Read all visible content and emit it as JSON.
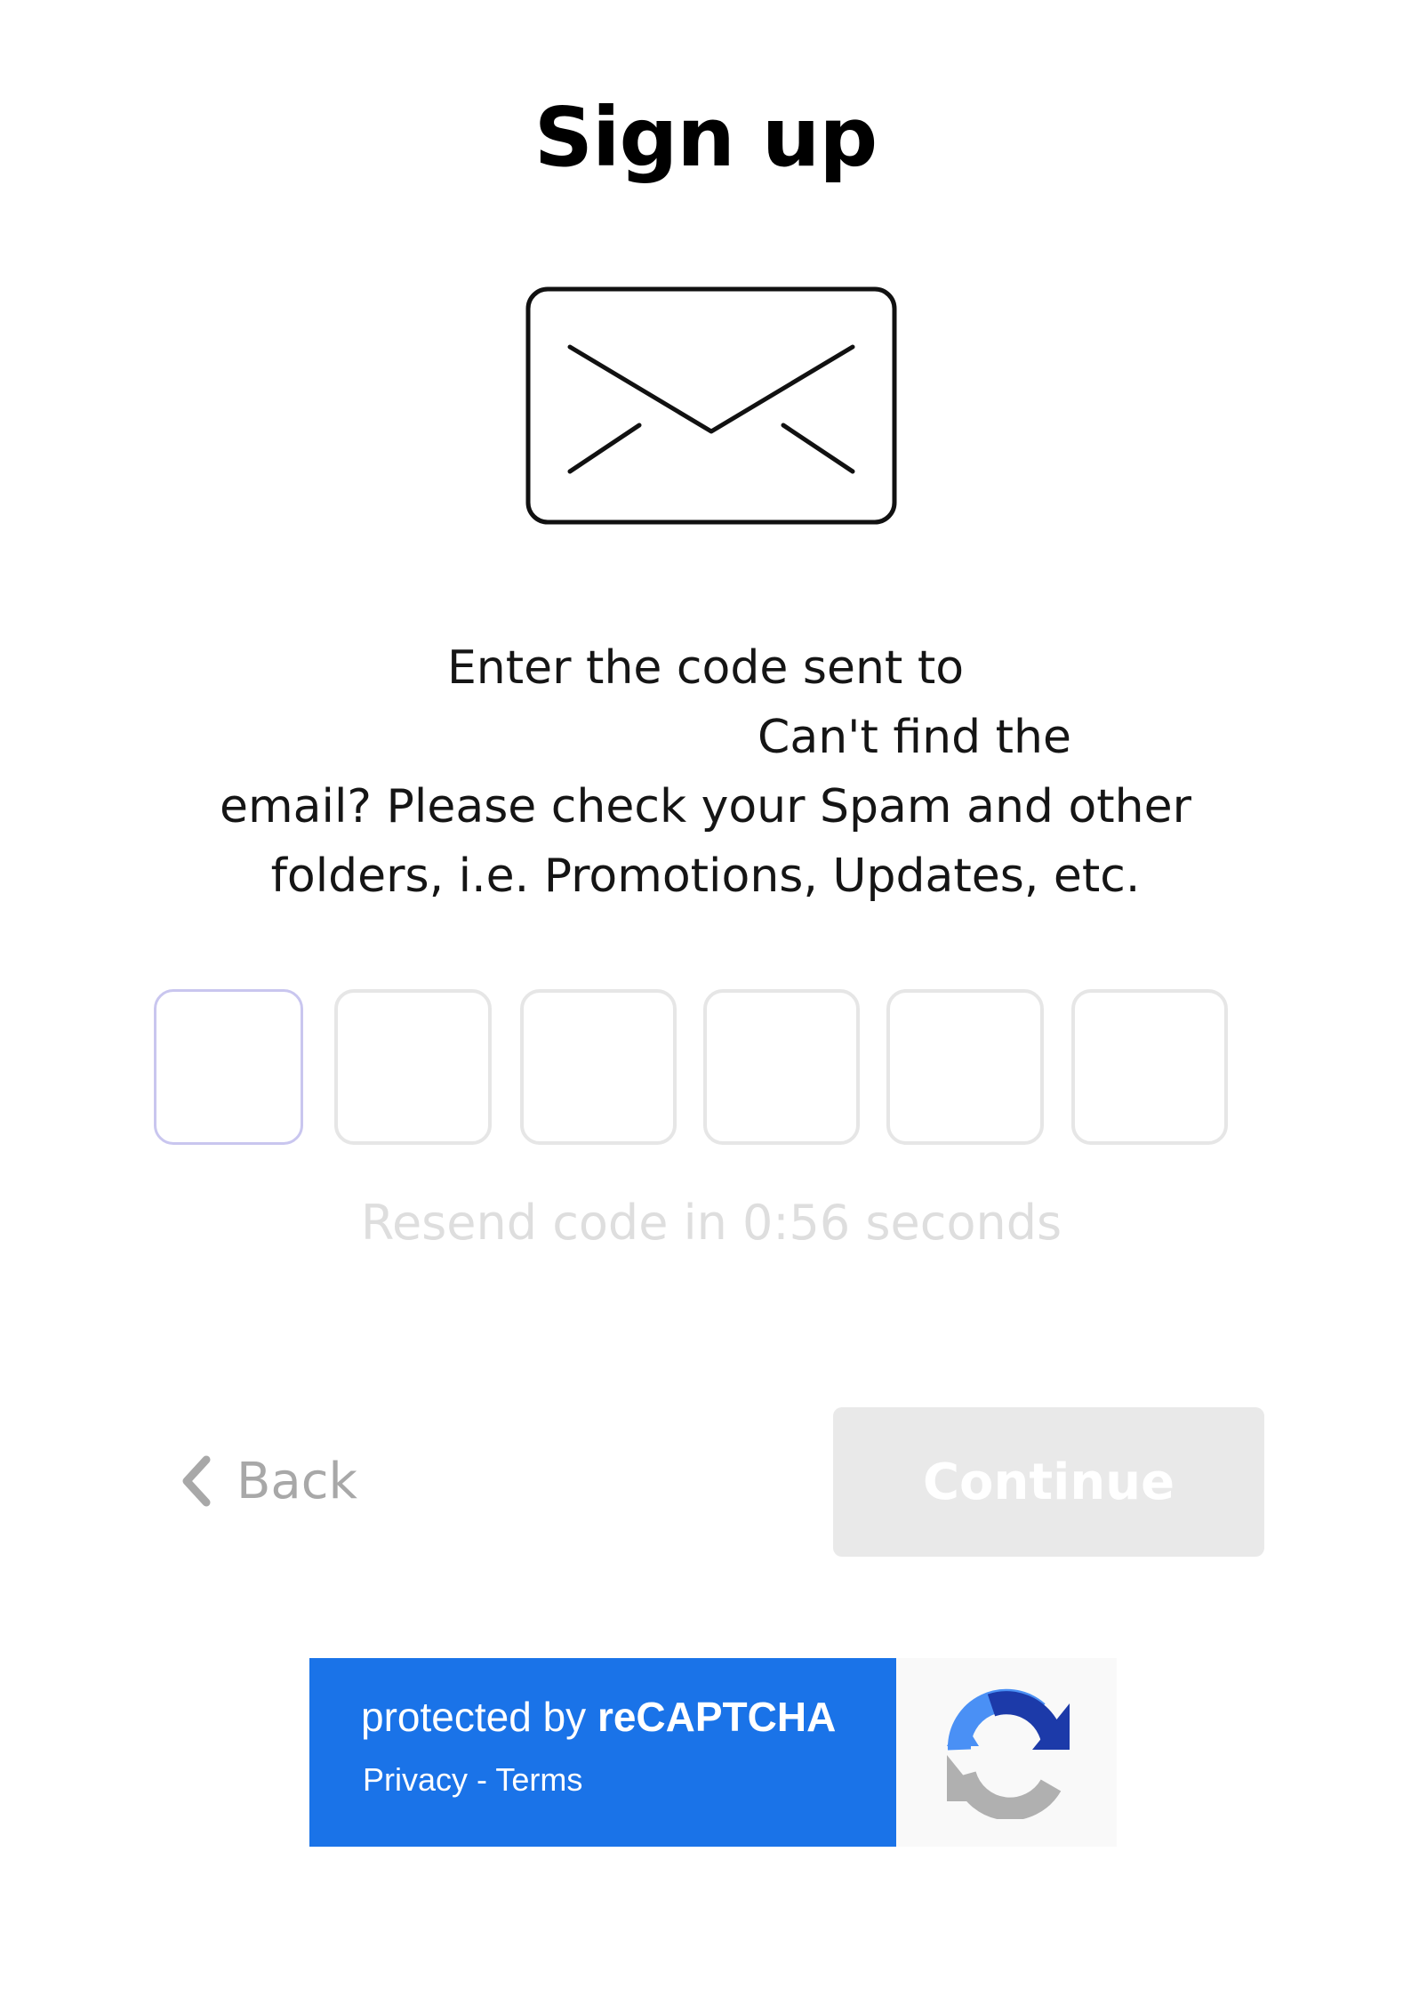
{
  "page": {
    "title": "Sign up"
  },
  "message": {
    "line_1": "Enter the code sent to",
    "line_2": "Can't find the",
    "line_3": "email? Please check your Spam and other",
    "line_4": "folders, i.e. Promotions, Updates, etc."
  },
  "code_inputs": {
    "count": 6,
    "values": [
      "",
      "",
      "",
      "",
      "",
      ""
    ],
    "focused_index": 0
  },
  "resend": {
    "text": "Resend code in 0:56 seconds"
  },
  "actions": {
    "back_label": "Back",
    "continue_label": "Continue"
  },
  "recaptcha": {
    "protected_by": "protected by ",
    "brand": "reCAPTCHA",
    "privacy": "Privacy",
    "separator": " - ",
    "terms": "Terms",
    "colors": {
      "panel": "#1a73e8",
      "arrow_blue": "#4a90f5",
      "arrow_dark": "#1c3aa9",
      "arrow_gray": "#b0b0b0"
    }
  },
  "icons": {
    "envelope": "envelope-icon",
    "back": "chevron-left-icon",
    "recaptcha": "recaptcha-logo-icon"
  }
}
